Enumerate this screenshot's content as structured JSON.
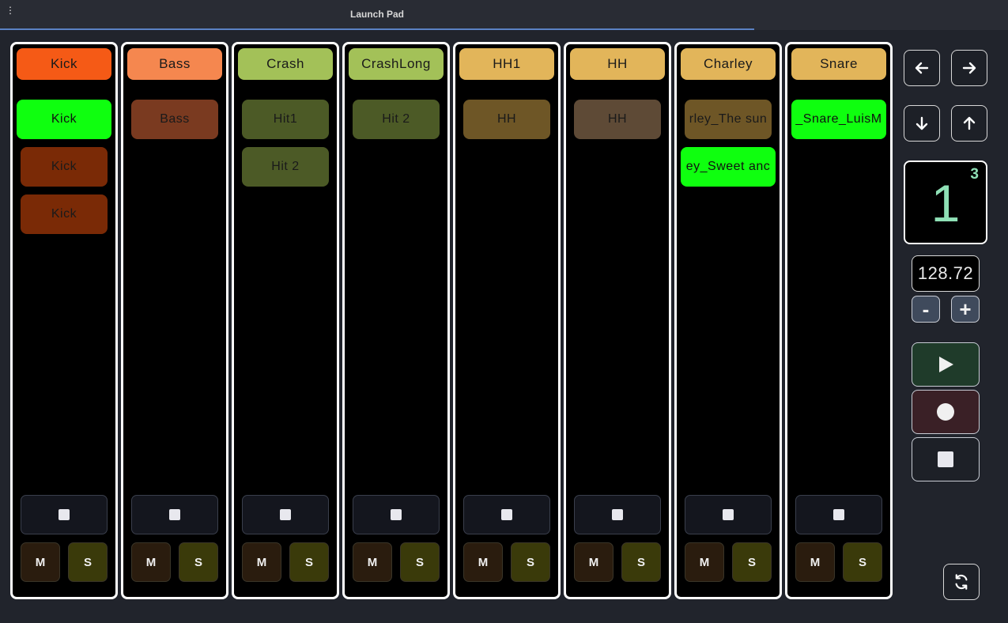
{
  "app": {
    "title": "Launch Pad",
    "menu_icon": "vertical-dots-icon"
  },
  "tracks": [
    {
      "name": "Kick",
      "header_color": "#f55a16",
      "clips": [
        {
          "label": "Kick",
          "state": "playing",
          "color": "#0fff0f"
        },
        {
          "label": "Kick",
          "state": "stopped",
          "color": "#7a2a06"
        },
        {
          "label": "Kick",
          "state": "stopped",
          "color": "#7a2a06"
        }
      ],
      "mute_label": "M",
      "solo_label": "S"
    },
    {
      "name": "Bass",
      "header_color": "#f5874f",
      "clips": [
        {
          "label": "Bass",
          "state": "stopped",
          "color": "#7a3a20"
        }
      ],
      "mute_label": "M",
      "solo_label": "S"
    },
    {
      "name": "Crash",
      "header_color": "#a3c158",
      "clips": [
        {
          "label": "Hit1",
          "state": "stopped",
          "color": "#4c5a26"
        },
        {
          "label": "Hit 2",
          "state": "stopped",
          "color": "#4c5a26"
        }
      ],
      "mute_label": "M",
      "solo_label": "S"
    },
    {
      "name": "CrashLong",
      "header_color": "#a3c158",
      "clips": [
        {
          "label": "Hit 2",
          "state": "stopped",
          "color": "#4c5a26"
        }
      ],
      "mute_label": "M",
      "solo_label": "S"
    },
    {
      "name": "HH1",
      "header_color": "#e2b55a",
      "clips": [
        {
          "label": "HH",
          "state": "stopped",
          "color": "#6e5626"
        }
      ],
      "mute_label": "M",
      "solo_label": "S"
    },
    {
      "name": "HH",
      "header_color": "#e2b55a",
      "clips": [
        {
          "label": "HH",
          "state": "stopped",
          "color": "#5e4a36"
        }
      ],
      "mute_label": "M",
      "solo_label": "S"
    },
    {
      "name": "Charley",
      "header_color": "#e2b55a",
      "clips": [
        {
          "label": "rley_The sun",
          "state": "stopped",
          "color": "#6e5626"
        },
        {
          "label": "ey_Sweet anc",
          "state": "playing",
          "color": "#0fff0f"
        }
      ],
      "mute_label": "M",
      "solo_label": "S"
    },
    {
      "name": "Snare",
      "header_color": "#e2b55a",
      "clips": [
        {
          "label": "_Snare_LuisM",
          "state": "playing",
          "color": "#0fff0f"
        }
      ],
      "mute_label": "M",
      "solo_label": "S"
    }
  ],
  "controls": {
    "nav_icons": [
      "arrow-left-icon",
      "arrow-right-icon",
      "arrow-down-icon",
      "arrow-up-icon"
    ],
    "scene_number": "1",
    "scene_count": "3",
    "tempo": "128.72",
    "tempo_minus_label": "-",
    "tempo_plus_label": "+",
    "play_color": "#1f3b2a",
    "record_color": "#3a2026",
    "stop_color": "#1d2027",
    "refresh_icon": "refresh-icon"
  }
}
